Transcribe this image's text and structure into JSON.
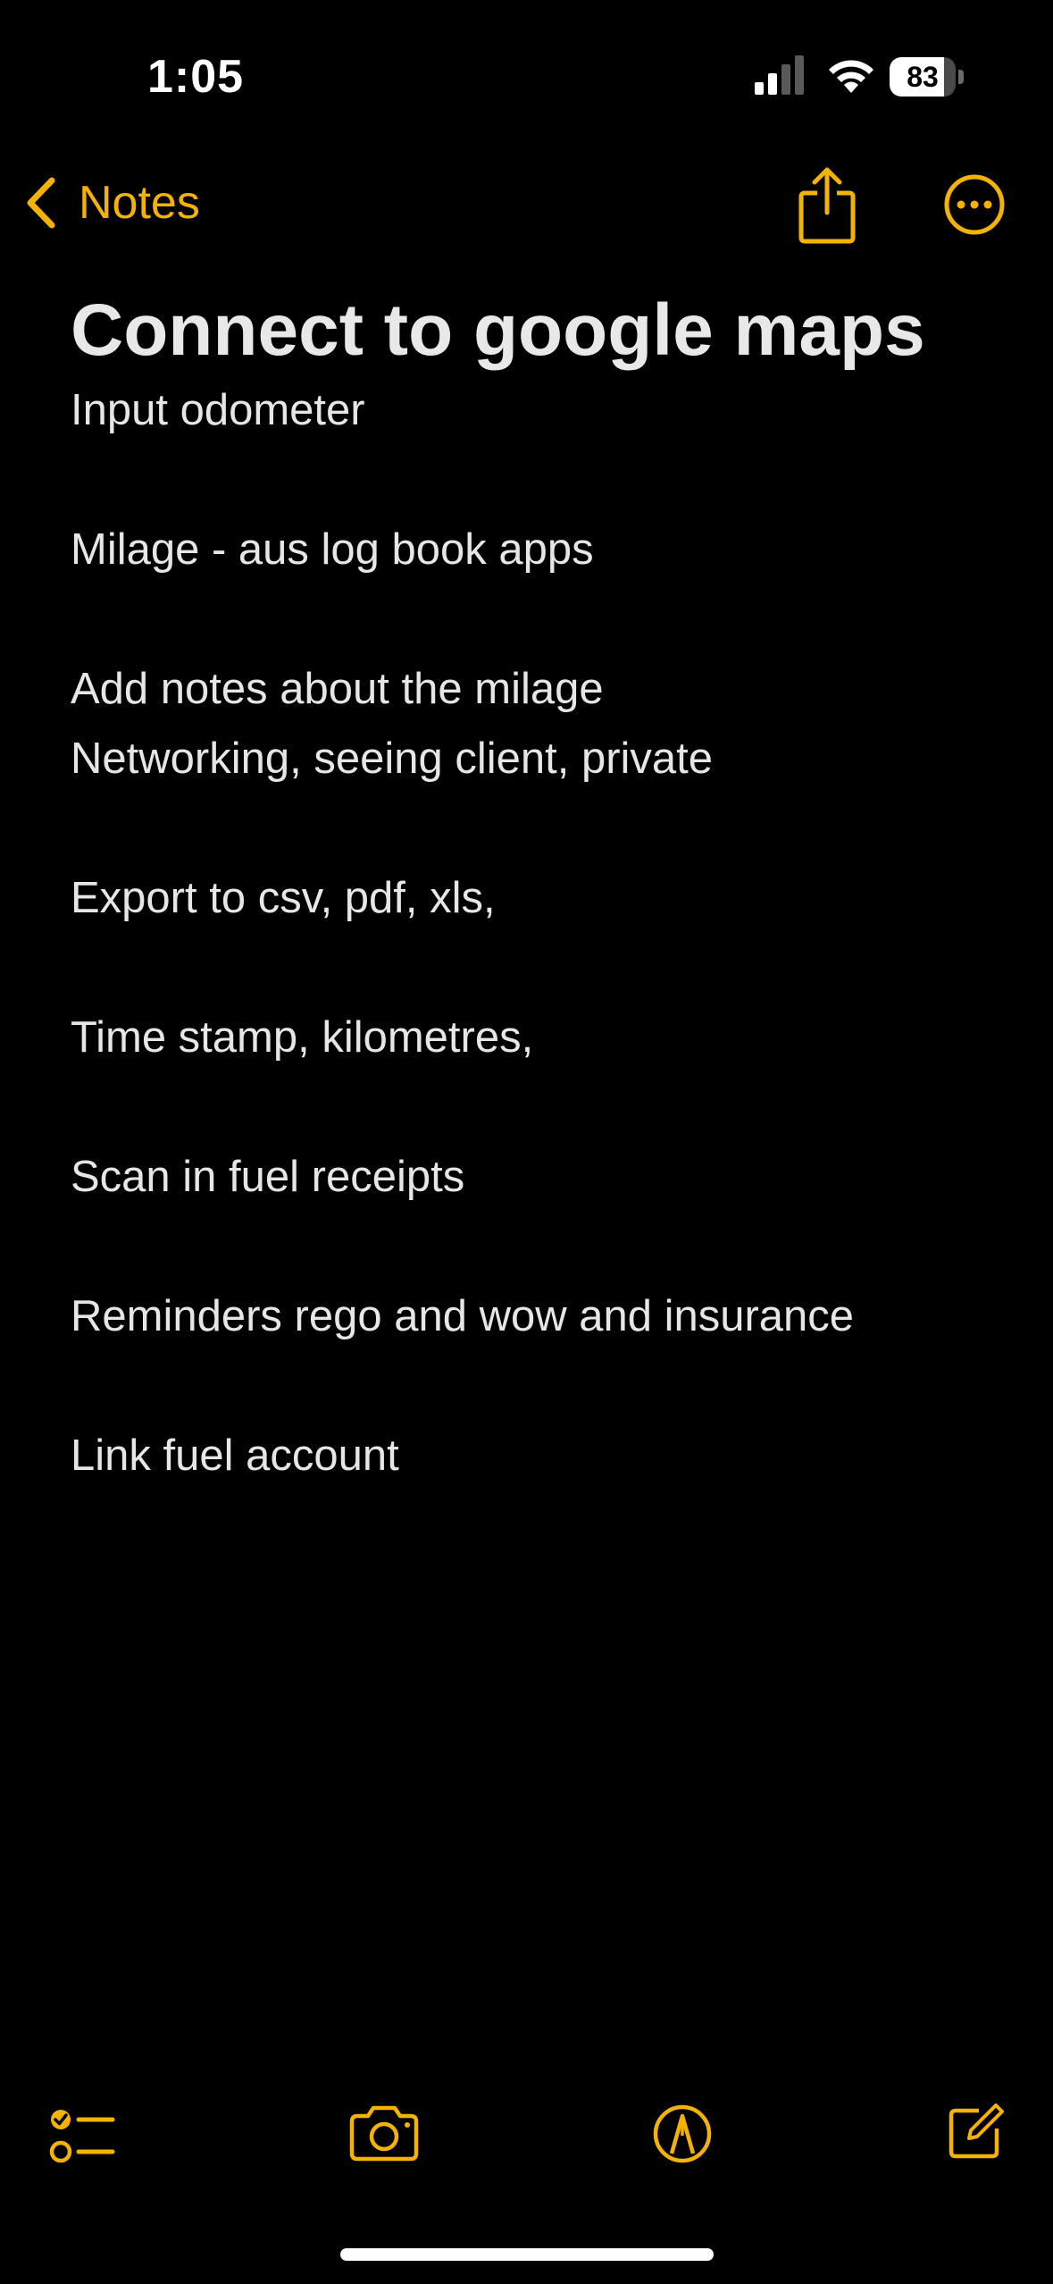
{
  "status_bar": {
    "time": "1:05",
    "battery": "83",
    "battery_level": 0.83
  },
  "nav": {
    "back_label": "Notes"
  },
  "note": {
    "title": "Connect to google maps",
    "lines": [
      "Input odometer",
      "",
      "Milage - aus log book apps",
      "",
      "Add notes about the milage",
      "Networking, seeing client, private",
      "",
      "Export to csv, pdf, xls,",
      "",
      "Time stamp, kilometres,",
      "",
      "Scan in fuel receipts",
      "",
      "Reminders rego and wow and insurance",
      "",
      "Link fuel account"
    ]
  },
  "colors": {
    "accent": "#f5b301",
    "background": "#000000",
    "text": "#e8e8e8"
  },
  "icons": {
    "back": "chevron-left-icon",
    "share": "share-icon",
    "more": "more-ellipsis-icon",
    "checklist": "checklist-icon",
    "camera": "camera-icon",
    "markup": "markup-pen-icon",
    "compose": "compose-icon"
  }
}
